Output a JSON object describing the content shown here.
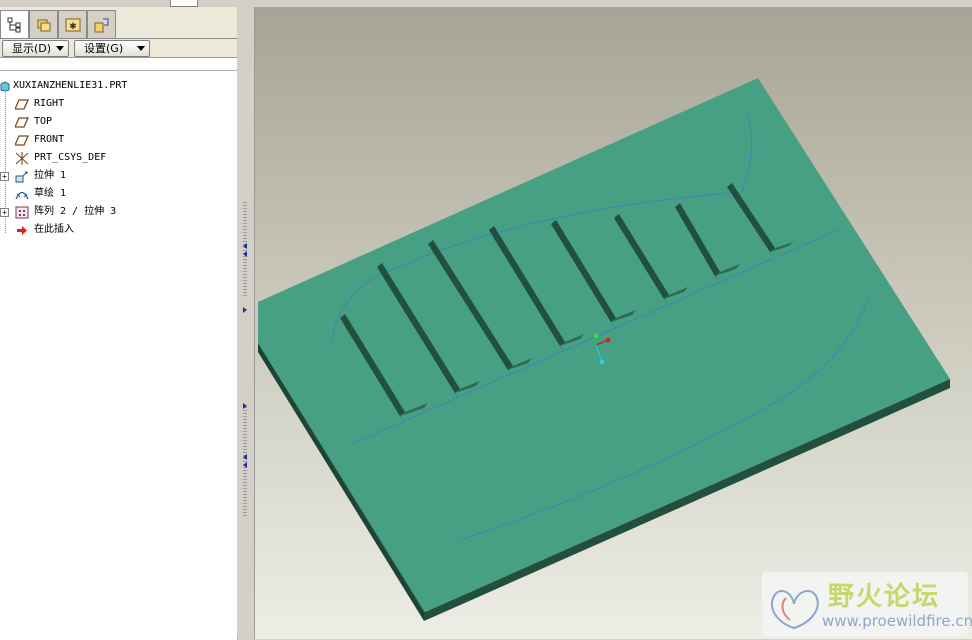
{
  "panel": {
    "tabs": [
      {
        "icon": "model-tree-icon",
        "active": true
      },
      {
        "icon": "folder-browser-icon",
        "active": false
      },
      {
        "icon": "favorites-icon",
        "active": false
      },
      {
        "icon": "connections-icon",
        "active": false
      }
    ],
    "show_menu": "显示(D)",
    "settings_menu": "设置(G)"
  },
  "tree": {
    "root": "XUXIANZHENLIE31.PRT",
    "items": [
      {
        "label": "RIGHT",
        "icon": "datum-plane-icon",
        "expandable": false
      },
      {
        "label": "TOP",
        "icon": "datum-plane-icon",
        "expandable": false
      },
      {
        "label": "FRONT",
        "icon": "datum-plane-icon",
        "expandable": false
      },
      {
        "label": "PRT_CSYS_DEF",
        "icon": "coordinate-system-icon",
        "expandable": false
      },
      {
        "label": "拉伸 1",
        "icon": "extrude-icon",
        "expandable": true
      },
      {
        "label": "草绘 1",
        "icon": "sketch-icon",
        "expandable": false
      },
      {
        "label": "阵列 2 / 拉伸 3",
        "icon": "pattern-icon",
        "expandable": true
      },
      {
        "label": "在此插入",
        "icon": "insert-here-arrow-icon",
        "expandable": false
      }
    ]
  },
  "viewport": {
    "plate_color": "#47a084",
    "plate_side_color": "#22503f",
    "slot_count": 8,
    "curve_color": "#3f88b4"
  },
  "watermark": {
    "title": "野火论坛",
    "url": "www.proewildfire.cn"
  }
}
